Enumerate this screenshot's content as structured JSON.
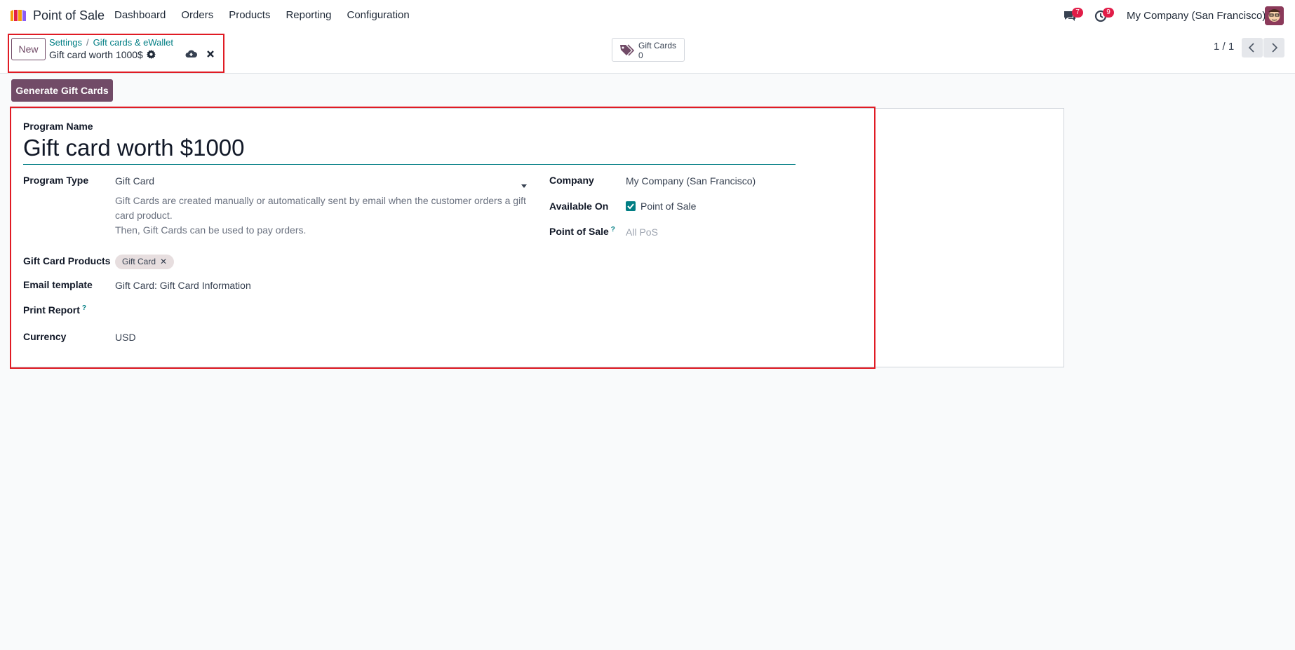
{
  "navbar": {
    "app_name": "Point of Sale",
    "menu": [
      "Dashboard",
      "Orders",
      "Products",
      "Reporting",
      "Configuration"
    ],
    "messages_count": "7",
    "activities_count": "9",
    "company": "My Company (San Francisco)"
  },
  "control_panel": {
    "new_label": "New",
    "breadcrumb": [
      "Settings",
      "Gift cards & eWallet"
    ],
    "breadcrumb_separator": "/",
    "record_title": "Gift card worth 1000$",
    "smart_button": {
      "label": "Gift Cards",
      "count": "0"
    },
    "pager": "1 / 1"
  },
  "actions": {
    "generate_label": "Generate Gift Cards"
  },
  "form": {
    "program_name_label": "Program Name",
    "program_name": "Gift card worth $1000",
    "program_type_label": "Program Type",
    "program_type": "Gift Card",
    "program_type_desc_1": "Gift Cards are created manually or automatically sent by email when the customer orders a gift card product.",
    "program_type_desc_2": "Then, Gift Cards can be used to pay orders.",
    "gift_card_products_label": "Gift Card Products",
    "gift_card_products": [
      "Gift Card"
    ],
    "email_template_label": "Email template",
    "email_template": "Gift Card: Gift Card Information",
    "print_report_label": "Print Report",
    "print_report_help": "?",
    "currency_label": "Currency",
    "currency": "USD",
    "company_label": "Company",
    "company": "My Company (San Francisco)",
    "available_on_label": "Available On",
    "available_on": "Point of Sale",
    "available_on_checked": true,
    "pos_label": "Point of Sale",
    "pos_help": "?",
    "pos_placeholder": "All PoS"
  },
  "colors": {
    "brand": "#714b67",
    "accent": "#017e84",
    "badge": "#e11d48",
    "highlight": "#e01b24"
  }
}
